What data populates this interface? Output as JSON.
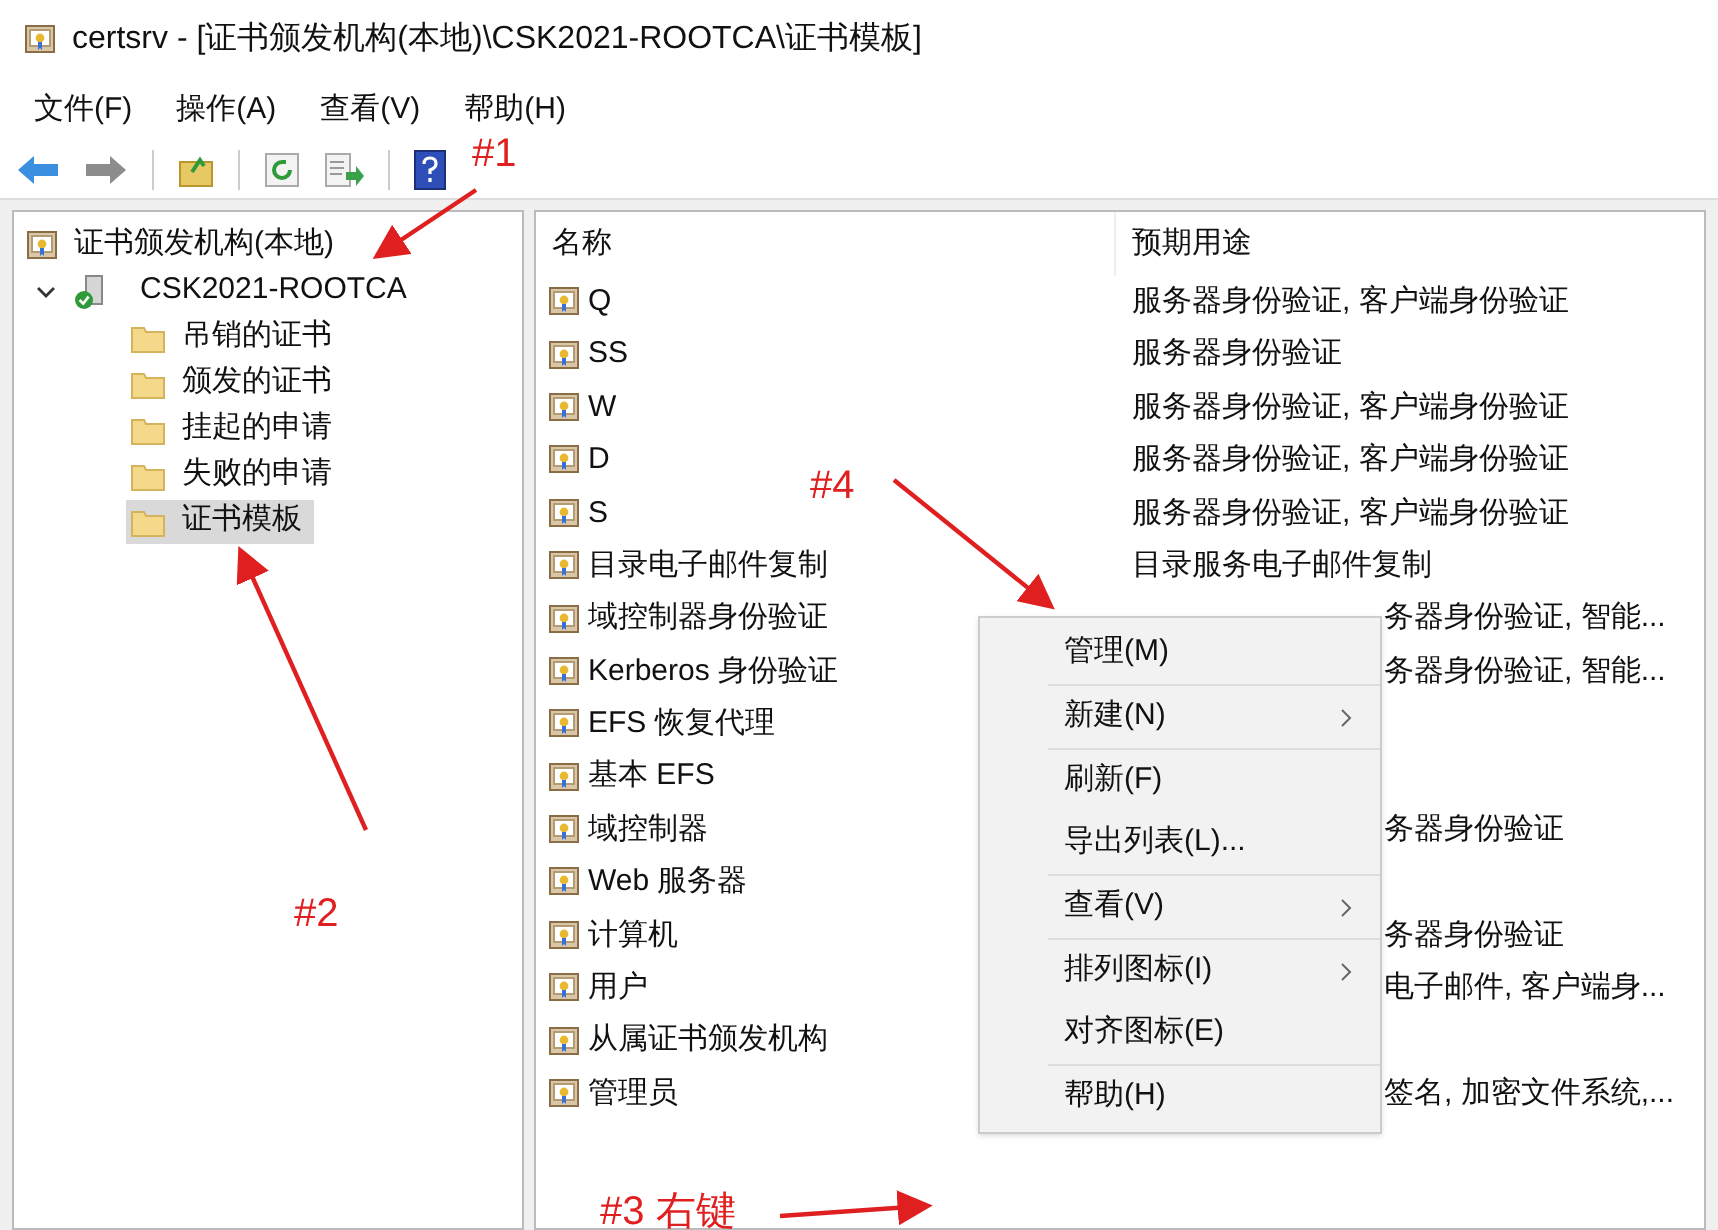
{
  "window": {
    "title": "certsrv - [证书颁发机构(本地)\\CSK2021-ROOTCA\\证书模板]"
  },
  "menu_bar": [
    "文件(F)",
    "操作(A)",
    "查看(V)",
    "帮助(H)"
  ],
  "tree": {
    "label": "证书颁发机构(本地)",
    "children": [
      {
        "label": "CSK2021-ROOTCA",
        "expanded": true,
        "children": [
          {
            "label": "吊销的证书",
            "selected": false
          },
          {
            "label": "颁发的证书",
            "selected": false
          },
          {
            "label": "挂起的申请",
            "selected": false
          },
          {
            "label": "失败的申请",
            "selected": false
          },
          {
            "label": "证书模板",
            "selected": true
          }
        ]
      }
    ]
  },
  "table": {
    "columns": [
      "名称",
      "预期用途"
    ],
    "rows": [
      {
        "name": "Q",
        "purpose": "服务器身份验证, 客户端身份验证",
        "kind": "full"
      },
      {
        "name": "SS",
        "purpose": "服务器身份验证",
        "kind": "full"
      },
      {
        "name": "W",
        "purpose": "服务器身份验证, 客户端身份验证",
        "kind": "full"
      },
      {
        "name": "D",
        "purpose": "服务器身份验证, 客户端身份验证",
        "kind": "full"
      },
      {
        "name": "S",
        "purpose": "服务器身份验证, 客户端身份验证",
        "kind": "full"
      },
      {
        "name": "目录电子邮件复制",
        "purpose": "目录服务电子邮件复制",
        "kind": "full"
      },
      {
        "name": "域控制器身份验证",
        "purpose": "务器身份验证, 智能...",
        "kind": "clipped"
      },
      {
        "name": "Kerberos 身份验证",
        "purpose": "务器身份验证, 智能...",
        "kind": "clipped"
      },
      {
        "name": "EFS 恢复代理",
        "kind": "hidden"
      },
      {
        "name": "基本 EFS",
        "kind": "hidden"
      },
      {
        "name": "域控制器",
        "purpose": "务器身份验证",
        "kind": "clipped"
      },
      {
        "name": "Web 服务器",
        "kind": "hidden"
      },
      {
        "name": "计算机",
        "purpose": "务器身份验证",
        "kind": "clipped"
      },
      {
        "name": "用户",
        "purpose": "电子邮件, 客户端身...",
        "kind": "clipped"
      },
      {
        "name": "从属证书颁发机构",
        "kind": "hidden"
      },
      {
        "name": "管理员",
        "purpose": "签名, 加密文件系统,...",
        "kind": "clipped"
      }
    ]
  },
  "context_menu": {
    "groups": [
      [
        {
          "label": "管理(M)",
          "submenu": false
        }
      ],
      [
        {
          "label": "新建(N)",
          "submenu": true
        }
      ],
      [
        {
          "label": "刷新(F)",
          "submenu": false
        },
        {
          "label": "导出列表(L)...",
          "submenu": false
        }
      ],
      [
        {
          "label": "查看(V)",
          "submenu": true
        }
      ],
      [
        {
          "label": "排列图标(I)",
          "submenu": true
        },
        {
          "label": "对齐图标(E)",
          "submenu": false
        }
      ],
      [
        {
          "label": "帮助(H)",
          "submenu": false
        }
      ]
    ]
  },
  "annotations": [
    "#1",
    "#2",
    "#3 右键",
    "#4"
  ]
}
